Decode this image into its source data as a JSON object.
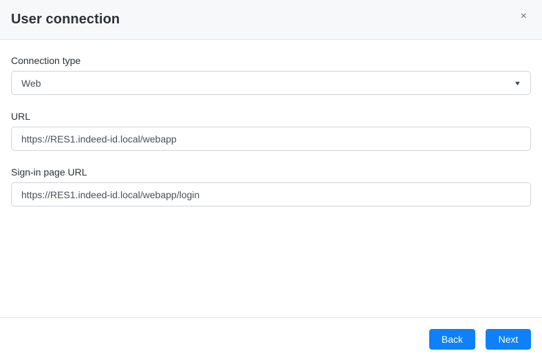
{
  "modal": {
    "title": "User connection",
    "close_icon": "×"
  },
  "form": {
    "connection_type": {
      "label": "Connection type",
      "value": "Web",
      "caret_icon": "▼"
    },
    "url": {
      "label": "URL",
      "value": "https://RES1.indeed-id.local/webapp"
    },
    "signin_url": {
      "label": "Sign-in page URL",
      "value": "https://RES1.indeed-id.local/webapp/login"
    }
  },
  "footer": {
    "back_label": "Back",
    "next_label": "Next"
  },
  "colors": {
    "primary": "#0e80f9",
    "header_bg": "#f7f8fa",
    "header_border": "#e2e5e9",
    "input_border": "#ced4da",
    "title_text": "#2c3237",
    "input_text": "#495057"
  }
}
